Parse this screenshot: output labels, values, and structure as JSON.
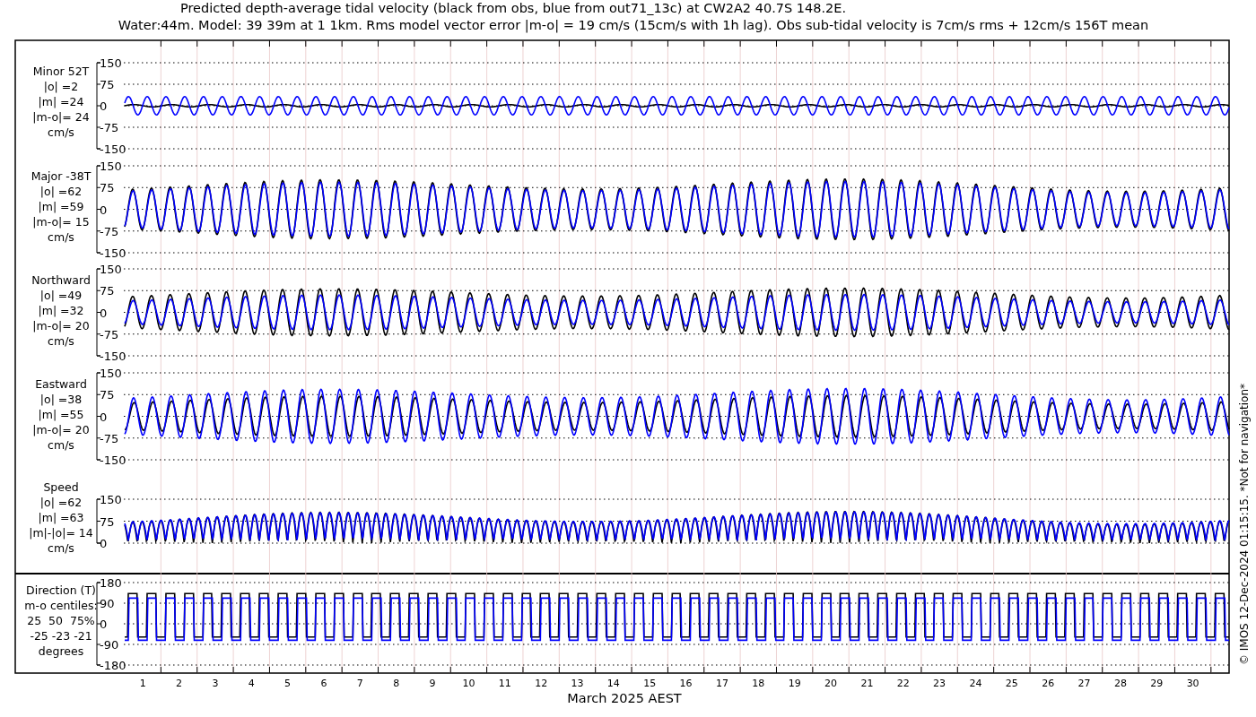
{
  "title": [
    "Predicted depth-average tidal velocity (black from obs, blue from out71_13c) at CW2A2 40.7S 148.2E.",
    "Water:44m. Model: 39 39m at 1 1km. Rms model vector error |m-o| = 19 cm/s (15cm/s with 1h lag). Obs sub-tidal velocity is 7cm/s rms + 12cm/s 156T mean"
  ],
  "series": [
    {
      "color": "#000000"
    },
    {
      "color": "#0000ff"
    }
  ],
  "panels": [
    {
      "kind": "minor",
      "label": [
        "Minor 52T",
        "|o| =2",
        "|m| =24",
        "|m-o|= 24",
        "cm/s"
      ],
      "yticks": [
        "150",
        "75",
        "0",
        "-75",
        "-150"
      ]
    },
    {
      "kind": "major",
      "label": [
        "Major -38T",
        "|o| =62",
        "|m| =59",
        "|m-o|= 15",
        "cm/s"
      ],
      "yticks": [
        "150",
        "75",
        "0",
        "-75",
        "-150"
      ]
    },
    {
      "kind": "north",
      "label": [
        "Northward",
        "|o| =49",
        "|m| =32",
        "|m-o|= 20",
        "cm/s"
      ],
      "yticks": [
        "150",
        "75",
        "0",
        "-75",
        "-150"
      ]
    },
    {
      "kind": "east",
      "label": [
        "Eastward",
        "|o| =38",
        "|m| =55",
        "|m-o|= 20",
        "cm/s"
      ],
      "yticks": [
        "150",
        "75",
        "0",
        "-75",
        "-150"
      ]
    },
    {
      "kind": "speed",
      "label": [
        "Speed",
        "|o| =62",
        "|m| =63",
        "|m|-|o|= 14",
        "cm/s"
      ],
      "yticks": [
        "150",
        "75",
        "0"
      ]
    },
    {
      "kind": "direction",
      "label": [
        "Direction (T)",
        "m-o centiles:",
        "25  50  75%",
        "-25 -23 -21",
        "degrees"
      ],
      "yticks": [
        "180",
        "90",
        "0",
        "-90",
        "-180"
      ]
    }
  ],
  "days": [
    "1",
    "2",
    "3",
    "4",
    "5",
    "6",
    "7",
    "8",
    "9",
    "10",
    "11",
    "12",
    "13",
    "14",
    "15",
    "16",
    "17",
    "18",
    "19",
    "20",
    "21",
    "22",
    "23",
    "24",
    "25",
    "26",
    "27",
    "28",
    "29",
    "30"
  ],
  "xlabel": "March 2025 AEST",
  "side_note": "© IMOS 12-Dec-2024 01:15:15. *Not for navigation*"
}
